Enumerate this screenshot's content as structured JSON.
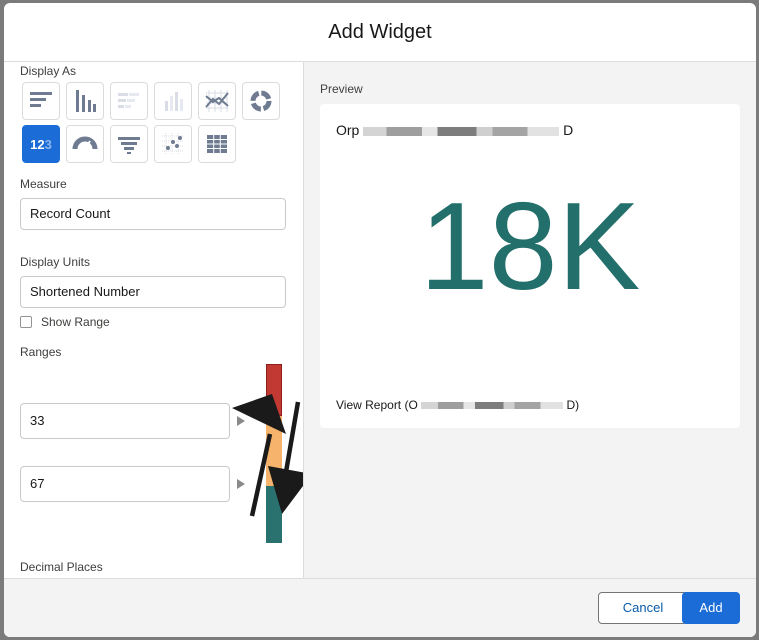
{
  "dialog": {
    "title": "Add Widget"
  },
  "left_panel": {
    "display_as_label": "Display As",
    "chart_types": [
      {
        "name": "horizontal-bar",
        "selected": false
      },
      {
        "name": "vertical-bar",
        "selected": false
      },
      {
        "name": "stacked-horizontal-bar",
        "selected": false
      },
      {
        "name": "stacked-vertical-bar",
        "selected": false
      },
      {
        "name": "line",
        "selected": false
      },
      {
        "name": "donut",
        "selected": false
      },
      {
        "name": "metric",
        "selected": true
      },
      {
        "name": "gauge",
        "selected": false
      },
      {
        "name": "funnel",
        "selected": false
      },
      {
        "name": "scatter",
        "selected": false
      },
      {
        "name": "table",
        "selected": false
      }
    ],
    "measure": {
      "label": "Measure",
      "value": "Record Count"
    },
    "display_units": {
      "label": "Display Units",
      "value": "Shortened Number"
    },
    "show_range": {
      "label": "Show Range",
      "checked": false
    },
    "ranges": {
      "label": "Ranges",
      "values": [
        "33",
        "67"
      ],
      "colors": [
        "#c23934",
        "#f5b36b",
        "#2a7270"
      ]
    },
    "decimal_places": {
      "label": "Decimal Places"
    }
  },
  "preview": {
    "label": "Preview",
    "report_title": "Orp",
    "report_title_end": "D",
    "metric_value": "18K",
    "metric_color": "#236f6b",
    "view_report_prefix": "View Report (O",
    "view_report_suffix": "D)"
  },
  "footer": {
    "cancel_label": "Cancel",
    "add_label": "Add"
  },
  "colors": {
    "brand": "#1b6cd6",
    "metric": "#236f6b"
  }
}
